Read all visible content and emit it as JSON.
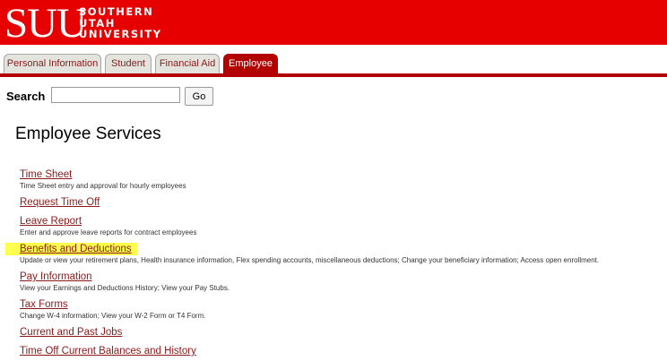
{
  "header": {
    "logo_mark": "SUU",
    "logo_line1": "SOUTHERN",
    "logo_line2": "UTAH",
    "logo_line3": "UNIVERSITY",
    "brand_color": "#e60000"
  },
  "tabs": [
    {
      "label": "Personal Information",
      "active": false
    },
    {
      "label": "Student",
      "active": false
    },
    {
      "label": "Financial Aid",
      "active": false
    },
    {
      "label": "Employee",
      "active": true
    }
  ],
  "search": {
    "label": "Search",
    "value": "",
    "placeholder": "",
    "button_label": "Go"
  },
  "page_title": "Employee Services",
  "menu": [
    {
      "label": "Time Sheet",
      "description": "Time Sheet entry and approval for hourly employees"
    },
    {
      "label": "Request Time Off",
      "description": ""
    },
    {
      "label": "Leave Report",
      "description": "Enter and approve leave reports for contract employees"
    },
    {
      "label": "Benefits and Deductions",
      "description": "Update or view your retirement plans, Health insurance information, Flex spending accounts, miscellaneous deductions; Change your beneficiary information; Access open enrollment.",
      "highlighted": true
    },
    {
      "label": "Pay Information",
      "description": "View your Earnings and Deductions History; View your Pay Stubs."
    },
    {
      "label": "Tax Forms",
      "description": "Change W-4 information; View your W-2 Form or T4 Form."
    },
    {
      "label": "Current and Past Jobs",
      "description": ""
    },
    {
      "label": "Time Off Current Balances and History",
      "description": ""
    }
  ],
  "colors": {
    "link": "#8b1a1a",
    "highlight": "#ffff4d",
    "active_tab": "#b30000"
  }
}
